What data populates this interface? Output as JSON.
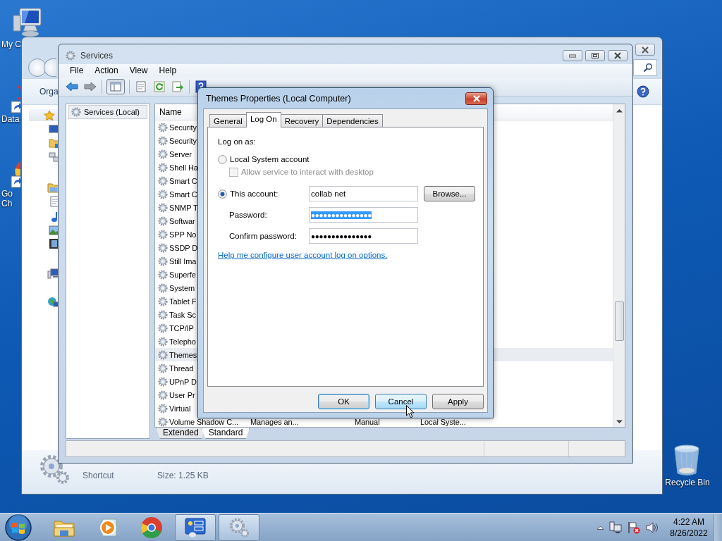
{
  "desktop_icons": [
    {
      "kind": "computer",
      "lines": [
        "My C"
      ]
    },
    {
      "kind": "app-shortcut",
      "lines": [
        "Data"
      ]
    },
    {
      "kind": "browser-shortcut",
      "lines": [
        "Go",
        "Ch"
      ]
    },
    {
      "kind": "recycle-bin",
      "lines": [
        "Recycle Bin"
      ]
    }
  ],
  "explorer": {
    "toolbar_label": "Orga",
    "details": {
      "type": "Shortcut",
      "size": "Size: 1.25 KB"
    }
  },
  "services_window": {
    "title": "Services",
    "menu": [
      "File",
      "Action",
      "View",
      "Help"
    ],
    "toolbar": [
      {
        "kind": "back",
        "pressed": false
      },
      {
        "kind": "forward",
        "pressed": false
      },
      {
        "kind": "console-tree",
        "pressed": true
      },
      {
        "kind": "properties",
        "pressed": false
      },
      {
        "kind": "refresh",
        "pressed": false
      },
      {
        "kind": "export",
        "pressed": false
      },
      {
        "kind": "help",
        "pressed": false
      }
    ],
    "tree": [
      {
        "label": "Services (Local)",
        "selected": true
      }
    ],
    "list": {
      "columns": [
        "Name"
      ],
      "rows": [
        {
          "cells": [
            "Security"
          ],
          "selected": false
        },
        {
          "cells": [
            "Security"
          ],
          "selected": false
        },
        {
          "cells": [
            "Server"
          ],
          "selected": false
        },
        {
          "cells": [
            "Shell Ha"
          ],
          "selected": false
        },
        {
          "cells": [
            "Smart C"
          ],
          "selected": false
        },
        {
          "cells": [
            "Smart C"
          ],
          "selected": false
        },
        {
          "cells": [
            "SNMP T"
          ],
          "selected": false
        },
        {
          "cells": [
            "Softwar"
          ],
          "selected": false
        },
        {
          "cells": [
            "SPP No"
          ],
          "selected": false
        },
        {
          "cells": [
            "SSDP D"
          ],
          "selected": false
        },
        {
          "cells": [
            "Still Ima"
          ],
          "selected": false
        },
        {
          "cells": [
            "Superfe"
          ],
          "selected": false
        },
        {
          "cells": [
            "System"
          ],
          "selected": false
        },
        {
          "cells": [
            "Tablet F"
          ],
          "selected": false
        },
        {
          "cells": [
            "Task Sc"
          ],
          "selected": false
        },
        {
          "cells": [
            "TCP/IP"
          ],
          "selected": false
        },
        {
          "cells": [
            "Telepho"
          ],
          "selected": false
        },
        {
          "cells": [
            "Themes"
          ],
          "selected": true
        },
        {
          "cells": [
            "Thread"
          ],
          "selected": false
        },
        {
          "cells": [
            "UPnP D"
          ],
          "selected": false
        },
        {
          "cells": [
            "User Pr"
          ],
          "selected": false
        },
        {
          "cells": [
            "Virtual"
          ],
          "selected": false
        },
        {
          "cells": [
            "Volume Shadow C...",
            "Manages an...",
            "Manual",
            "Local Syste..."
          ],
          "selected": false
        }
      ]
    },
    "view_tabs": [
      {
        "label": "Extended",
        "selected": false
      },
      {
        "label": "Standard",
        "selected": true
      }
    ]
  },
  "dialog": {
    "title": "Themes Properties (Local Computer)",
    "tabs": [
      {
        "label": "General",
        "selected": false
      },
      {
        "label": "Log On",
        "selected": true
      },
      {
        "label": "Recovery",
        "selected": false
      },
      {
        "label": "Dependencies",
        "selected": false
      }
    ],
    "heading": "Log on as:",
    "local_system": {
      "label": "Local System account",
      "selected": false
    },
    "interact": {
      "label": "Allow service to interact with desktop",
      "checked": false,
      "disabled": true
    },
    "this_account": {
      "label": "This account:",
      "selected": true,
      "value": "collab net"
    },
    "browse_button": "Browse...",
    "password": {
      "label": "Password:",
      "value": "●●●●●●●●●●●●●●●",
      "highlighted": true
    },
    "confirm_password": {
      "label": "Confirm password:",
      "value": "●●●●●●●●●●●●●●●",
      "highlighted": false
    },
    "help_link": "Help me configure user account log on options.",
    "buttons": [
      {
        "label": "OK",
        "default": true,
        "hovered": false
      },
      {
        "label": "Cancel",
        "default": false,
        "hovered": true
      },
      {
        "label": "Apply",
        "default": false,
        "hovered": false
      }
    ]
  },
  "taskbar": {
    "items": [
      {
        "kind": "explorer",
        "running": false
      },
      {
        "kind": "media-player",
        "running": false
      },
      {
        "kind": "browser",
        "running": false
      },
      {
        "kind": "control-panel",
        "running": true
      },
      {
        "kind": "services",
        "running": true
      }
    ],
    "clock": {
      "time": "4:22 AM",
      "date": "8/26/2022"
    }
  }
}
